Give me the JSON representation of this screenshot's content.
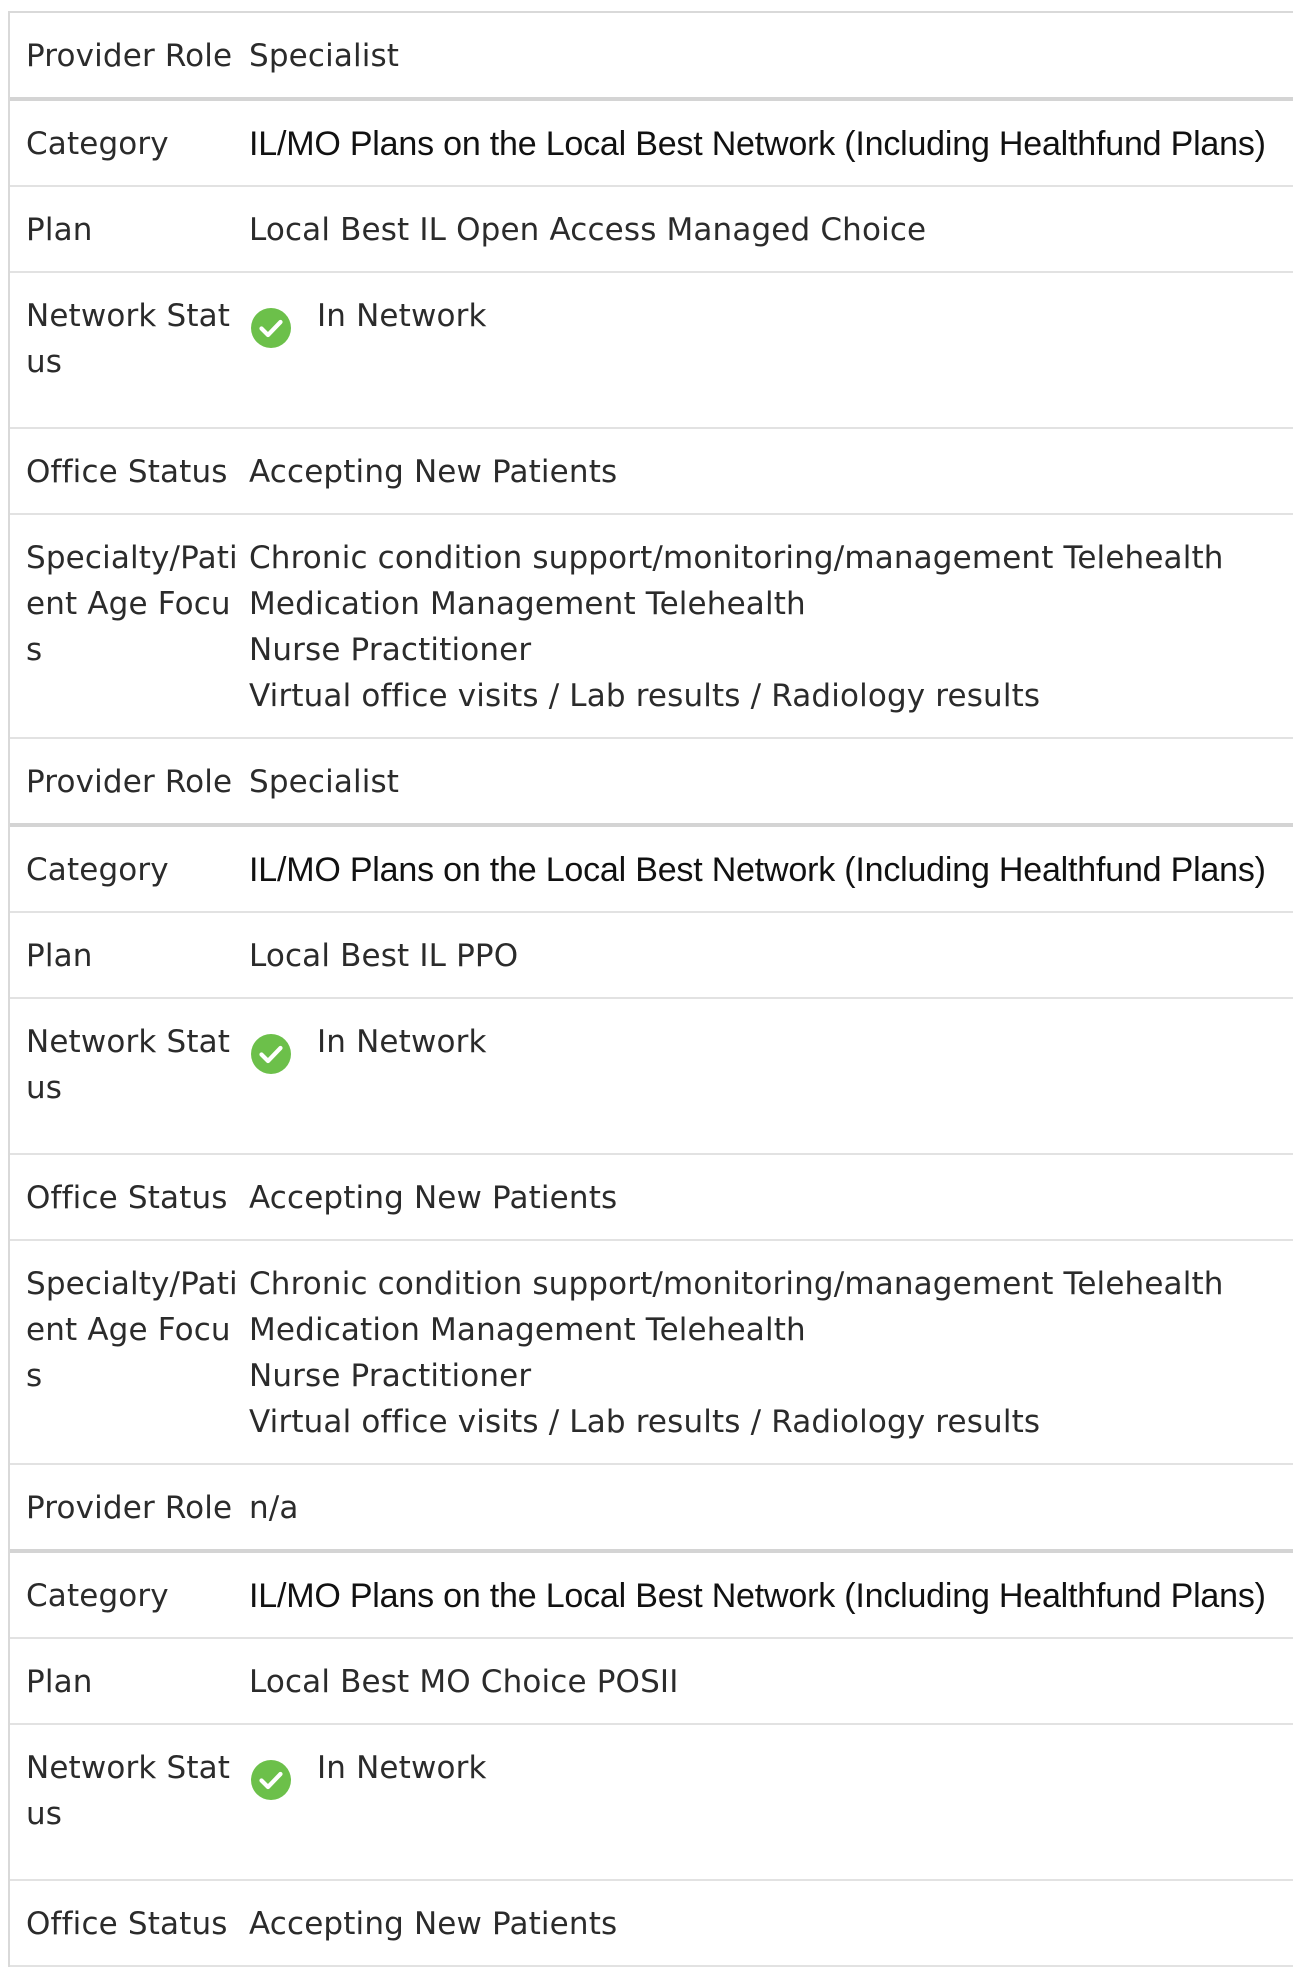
{
  "labels": {
    "provider_role": "Provider Role",
    "category": "Category",
    "plan": "Plan",
    "network_status": "Network Status",
    "office_status": "Office Status",
    "specialty": "Specialty/Patient Age Focus"
  },
  "colors": {
    "check_green": "#6cc04a"
  },
  "groups": [
    {
      "provider_role": "Specialist",
      "category": "IL/MO Plans on the Local Best Network (Including Healthfund Plans)",
      "plan": "Local Best IL Open Access Managed Choice",
      "network_status": "In Network",
      "network_icon": "check-circle-icon",
      "office_status": "Accepting New Patients",
      "specialties": [
        "Chronic condition support/monitoring/management Telehealth",
        "Medication Management Telehealth",
        "Nurse Practitioner",
        "Virtual office visits / Lab results / Radiology results"
      ]
    },
    {
      "provider_role": "Specialist",
      "category": "IL/MO Plans on the Local Best Network (Including Healthfund Plans)",
      "plan": "Local Best IL PPO",
      "network_status": "In Network",
      "network_icon": "check-circle-icon",
      "office_status": "Accepting New Patients",
      "specialties": [
        "Chronic condition support/monitoring/management Telehealth",
        "Medication Management Telehealth",
        "Nurse Practitioner",
        "Virtual office visits / Lab results / Radiology results"
      ]
    },
    {
      "provider_role": "n/a",
      "category": "IL/MO Plans on the Local Best Network (Including Healthfund Plans)",
      "plan": "Local Best MO Choice POSII",
      "network_status": "In Network",
      "network_icon": "check-circle-icon",
      "office_status": "Accepting New Patients",
      "specialties": []
    }
  ]
}
